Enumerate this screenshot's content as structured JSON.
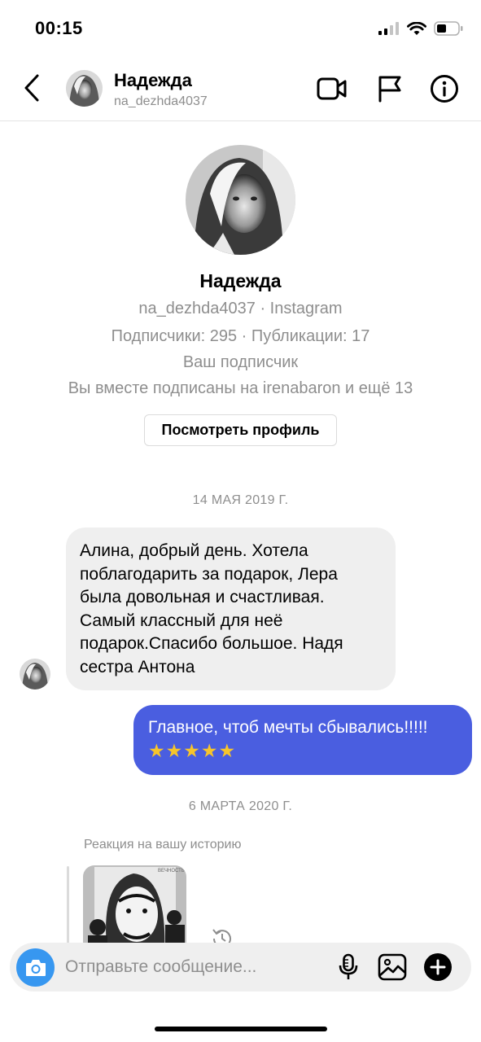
{
  "status_bar": {
    "time": "00:15"
  },
  "header": {
    "name": "Надежда",
    "username": "na_dezhda4037",
    "icons": [
      "back-chevron-icon",
      "video-call-icon",
      "flag-icon",
      "info-icon"
    ]
  },
  "profile": {
    "name": "Надежда",
    "username_line": "na_dezhda4037 · Instagram",
    "stats_line": "Подписчики: 295 · Публикации: 17",
    "follow_status": "Ваш подписчик",
    "mutual_line": "Вы вместе подписаны на irenabaron и ещё 13",
    "view_profile_label": "Посмотреть профиль"
  },
  "conversation": {
    "date_1": "14 МАЯ 2019 Г.",
    "incoming_message": "Алина, добрый день. Хотела поблагодарить за подарок, Лера была довольная и счастливая. Самый классный для неё подарок.Спасибо большое. Надя сестра Антона",
    "outgoing_message": "Главное, чтоб мечты сбывались!!!!!",
    "outgoing_stars": "★★★★★",
    "date_2": "6 МАРТА 2020 Г.",
    "story_reaction_label": "Реакция на вашу историю",
    "story_thumb_caption": "ВЕЧНОСТЬ"
  },
  "composer": {
    "placeholder": "Отправьте сообщение...",
    "icons": [
      "camera-icon",
      "microphone-icon",
      "gallery-icon",
      "add-icon"
    ]
  },
  "colors": {
    "accent_blue": "#3797f0",
    "outgoing_bubble": "#4a5ee0",
    "incoming_bubble": "#efefef",
    "secondary_text": "#8e8e8e"
  }
}
